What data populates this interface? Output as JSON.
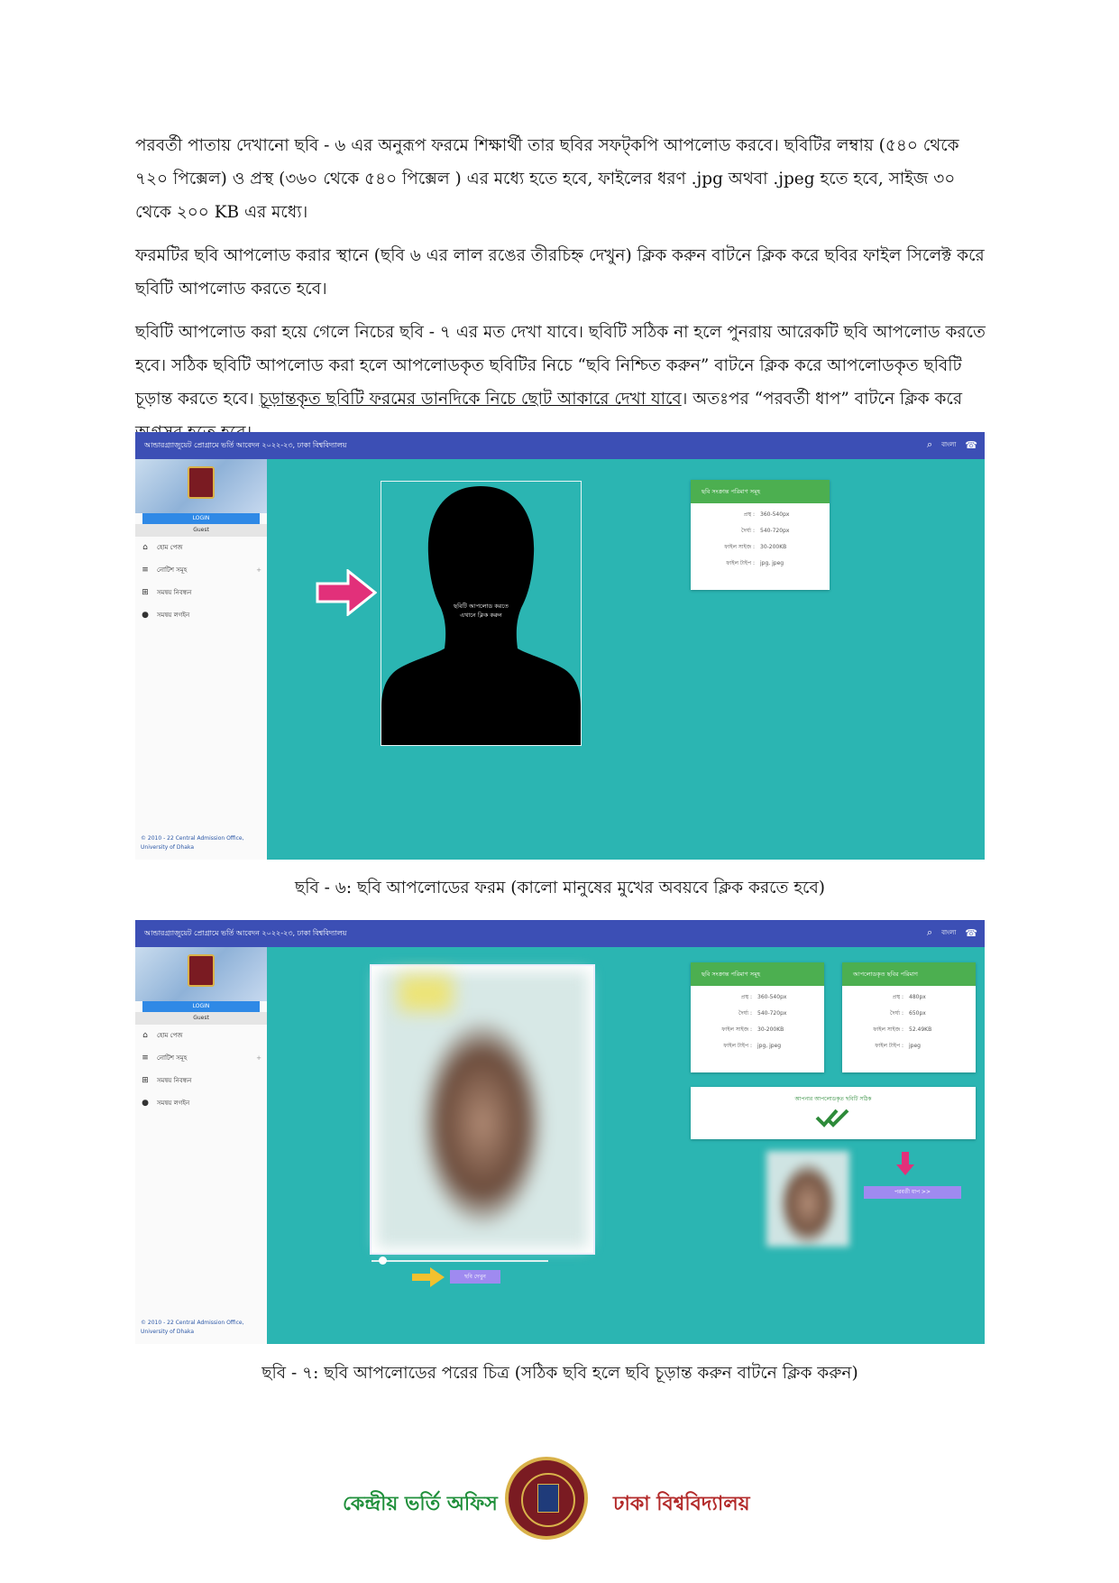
{
  "paragraphs": [
    "পরবর্তী পাতায় দেখানো ছবি - ৬ এর অনুরূপ ফরমে শিক্ষার্থী তার ছবির সফট্‌কপি আপলোড করবে। ছবিটির লম্বায় (৫৪০ থেকে ৭২০ পিক্সেল) ও প্রস্থ (৩৬০ থেকে ৫৪০ পিক্সেল ) এর মধ্যে হতে হবে, ফাইলের ধরণ .jpg অথবা .jpeg হতে হবে, সাইজ ৩০ থেকে ২০০ KB এর মধ্যে।",
    "ফরমটির ছবি আপলোড করার স্থানে (ছবি ৬ এর লাল রঙের তীরচিহ্ন দেখুন) ক্লিক করুন বাটনে ক্লিক করে ছবির ফাইল সিলেক্ট করে ছবিটি আপলোড করতে হবে।",
    "ছবিটি আপলোড করা হয়ে গেলে নিচের ছবি - ৭ এর মত দেখা যাবে। ছবিটি সঠিক না হলে পুনরায় আরেকটি ছবি আপলোড করতে হবে। সঠিক ছবিটি আপলোড করা হলে আপলোডকৃত ছবিটির নিচে “ছবি নিশ্চিত করুন” বাটনে ক্লিক করে আপলোডকৃত ছবিটি চূড়ান্ত করতে হবে।"
  ],
  "para3_underlined": "চূড়ান্তকৃত ছবিটি ফরমের ডানদিকে নিচে ছোট আকারে দেখা যাবে",
  "para3_tail_a": "। অতঃপর “পরবর্তী ধাপ” বাটনে ক্লিক করে অগ্রসর হতে হবে।",
  "screenshot": {
    "topbar_title": "আন্ডারগ্র্যাজুয়েট প্রোগ্রামে ভর্তি আবেদন ২০২২-২৩, ঢাকা বিশ্ববিদ্যালয়",
    "lang": "বাংলা",
    "login": "LOGIN",
    "guest": "Guest",
    "nav": [
      "হোম পেজ",
      "নোটিশ সমূহ",
      "সমন্বয় নিবন্ধন",
      "সমন্বয় লগইন"
    ],
    "footer_line1": "© 2010 - 22 Central Admission Office,",
    "footer_line2": "University of Dhaka",
    "upload_prompt_1": "ছবিটি আপলোড করতে",
    "upload_prompt_2": "এখানে ক্লিক করুন",
    "card1_title": "ছবি সংক্রান্ত পরিমাণ সমূহ",
    "card2_title": "আপলোডকৃত ছবির পরিমাণ",
    "req_rows": [
      {
        "k": "প্রস্থ :",
        "v": "360-540px"
      },
      {
        "k": "দৈর্ঘ্য :",
        "v": "540-720px"
      },
      {
        "k": "ফাইল সাইজ :",
        "v": "30-200KB"
      },
      {
        "k": "ফাইল টাইপ :",
        "v": "jpg, jpeg"
      }
    ],
    "up_rows": [
      {
        "k": "প্রস্থ :",
        "v": "480px"
      },
      {
        "k": "দৈর্ঘ্য :",
        "v": "650px"
      },
      {
        "k": "ফাইল সাইজ :",
        "v": "52.49KB"
      },
      {
        "k": "ফাইল টাইপ :",
        "v": "jpeg"
      }
    ],
    "ok_msg": "আপনার আপলোডকৃত ছবিটি সঠিক",
    "confirm_btn": "ছবি দেখুন",
    "next_btn": "পরবর্তী ধাপ >>"
  },
  "caption6": "ছবি - ৬: ছবি আপলোডের ফরম (কালো মানুষের মুখের অবয়বে ক্লিক করতে হবে)",
  "caption7": "ছবি - ৭: ছবি আপলোডের পরের চিত্র (সঠিক ছবি হলে ছবি চূড়ান্ত করুন বাটনে ক্লিক করুন)",
  "footer": {
    "left": "কেন্দ্রীয় ভর্তি অফিস",
    "right": "ঢাকা বিশ্ববিদ্যালয়"
  },
  "colors": {
    "teal": "#2bb5b2",
    "topbar": "#3c4fb5",
    "green": "#4caf50",
    "pink_arrow": "#e2307a",
    "yellow_arrow": "#f2c12e"
  }
}
